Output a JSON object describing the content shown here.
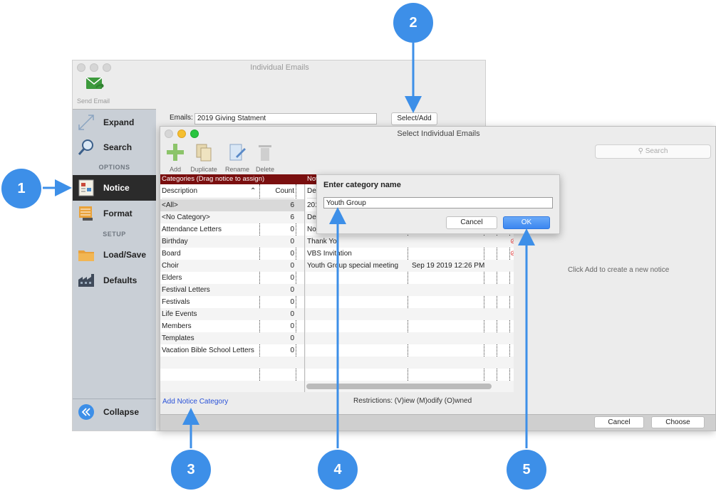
{
  "main_window": {
    "title": "Individual Emails",
    "toolbar": {
      "send_email_label": "Send Email"
    },
    "sidebar": {
      "items": [
        {
          "label": "Expand",
          "icon": "expand-icon"
        },
        {
          "label": "Search",
          "icon": "magnifier-icon"
        },
        {
          "label": "Notice",
          "icon": "notice-icon",
          "active": true
        },
        {
          "label": "Format",
          "icon": "format-icon"
        },
        {
          "label": "Load/Save",
          "icon": "folder-icon"
        },
        {
          "label": "Defaults",
          "icon": "factory-icon"
        },
        {
          "label": "Collapse",
          "icon": "collapse-chevron-icon"
        }
      ],
      "sections": {
        "options": "OPTIONS",
        "setup": "SETUP"
      }
    },
    "emails_label": "Emails:",
    "emails_value": "2019 Giving Statment",
    "select_add_label": "Select/Add"
  },
  "dialog": {
    "title": "Select Individual Emails",
    "toolbar": {
      "add": "Add",
      "duplicate": "Duplicate",
      "rename": "Rename",
      "delete": "Delete"
    },
    "search_placeholder": "Search",
    "categories_header": "Categories (Drag notice to assign)",
    "notices_header": "Not",
    "columns": {
      "description": "Description",
      "count": "Count",
      "notice_description": "Des"
    },
    "categories": [
      {
        "name": "<All>",
        "count": "6"
      },
      {
        "name": "<No Category>",
        "count": "6"
      },
      {
        "name": "Attendance Letters",
        "count": "0"
      },
      {
        "name": "Birthday",
        "count": "0"
      },
      {
        "name": "Board",
        "count": "0"
      },
      {
        "name": "Choir",
        "count": "0"
      },
      {
        "name": "Elders",
        "count": "0"
      },
      {
        "name": "Festival Letters",
        "count": "0"
      },
      {
        "name": "Festivals",
        "count": "0"
      },
      {
        "name": "Life Events",
        "count": "0"
      },
      {
        "name": "Members",
        "count": "0"
      },
      {
        "name": "Templates",
        "count": "0"
      },
      {
        "name": "Vacation Bible School Letters",
        "count": "0"
      }
    ],
    "notices": [
      {
        "desc": "201",
        "time": ""
      },
      {
        "desc": "Der",
        "time": ""
      },
      {
        "desc": "Not",
        "time": ""
      },
      {
        "desc": "Thank Yo",
        "time": ""
      },
      {
        "desc": "VBS Invitation",
        "time": ""
      },
      {
        "desc": "Youth Group special meeting",
        "time": "Sep 19 2019 12:26 PM"
      }
    ],
    "add_category_link": "Add Notice Category",
    "restrictions": "Restrictions: (V)iew (M)odify (O)wned",
    "click_add_hint": "Click Add to create a new notice",
    "cancel": "Cancel",
    "choose": "Choose"
  },
  "popup": {
    "title": "Enter category name",
    "input_value": "Youth Group",
    "cancel": "Cancel",
    "ok": "OK"
  },
  "callouts": [
    "1",
    "2",
    "3",
    "4",
    "5"
  ],
  "colors": {
    "accent": "#3d8fe8",
    "header_red": "#7a0f0f",
    "link_blue": "#2a52d8"
  }
}
